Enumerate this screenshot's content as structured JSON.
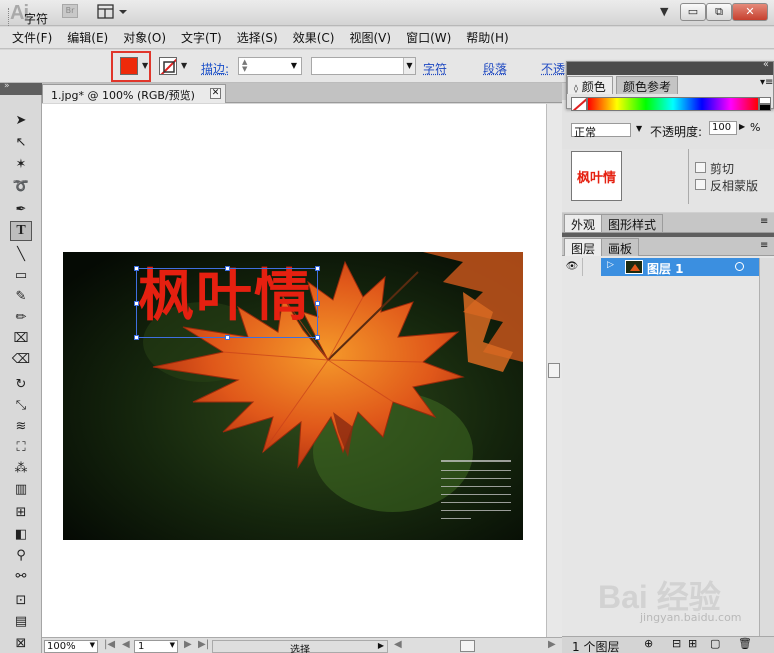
{
  "app": {
    "logo": "Ai",
    "bridge_badge": "Br"
  },
  "window_controls": {
    "minimize": "▭",
    "restore": "⧉",
    "close": "✕"
  },
  "menu": [
    "文件(F)",
    "编辑(E)",
    "对象(O)",
    "文字(T)",
    "选择(S)",
    "效果(C)",
    "视图(V)",
    "窗口(W)",
    "帮助(H)"
  ],
  "control_bar": {
    "context_label": "字符",
    "fill_color": "#ee2a0a",
    "stroke_label": "描边:",
    "links": [
      "字符",
      "段落",
      "不透"
    ]
  },
  "document": {
    "tab_title": "1.jpg* @ 100% (RGB/预览)",
    "zoom": "100%",
    "page": "1",
    "status_mode": "选择",
    "text_content": "枫叶情",
    "text_color": "#e52010"
  },
  "color_panel": {
    "tabs": [
      "颜色",
      "颜色参考"
    ],
    "blend_mode": "正常",
    "opacity_label": "不透明度:",
    "opacity_value": "100",
    "opacity_unit": "%",
    "thumbnail_text": "枫叶情",
    "clip_label": "剪切",
    "invert_label": "反相蒙版"
  },
  "appearance_tabs": [
    "外观",
    "图形样式"
  ],
  "layers": {
    "tabs": [
      "图层",
      "画板"
    ],
    "items": [
      {
        "name": "图层 1"
      }
    ],
    "footer_count": "1 个图层"
  },
  "watermark": {
    "text": "Bai 经验",
    "url": "jingyan.baidu.com"
  }
}
